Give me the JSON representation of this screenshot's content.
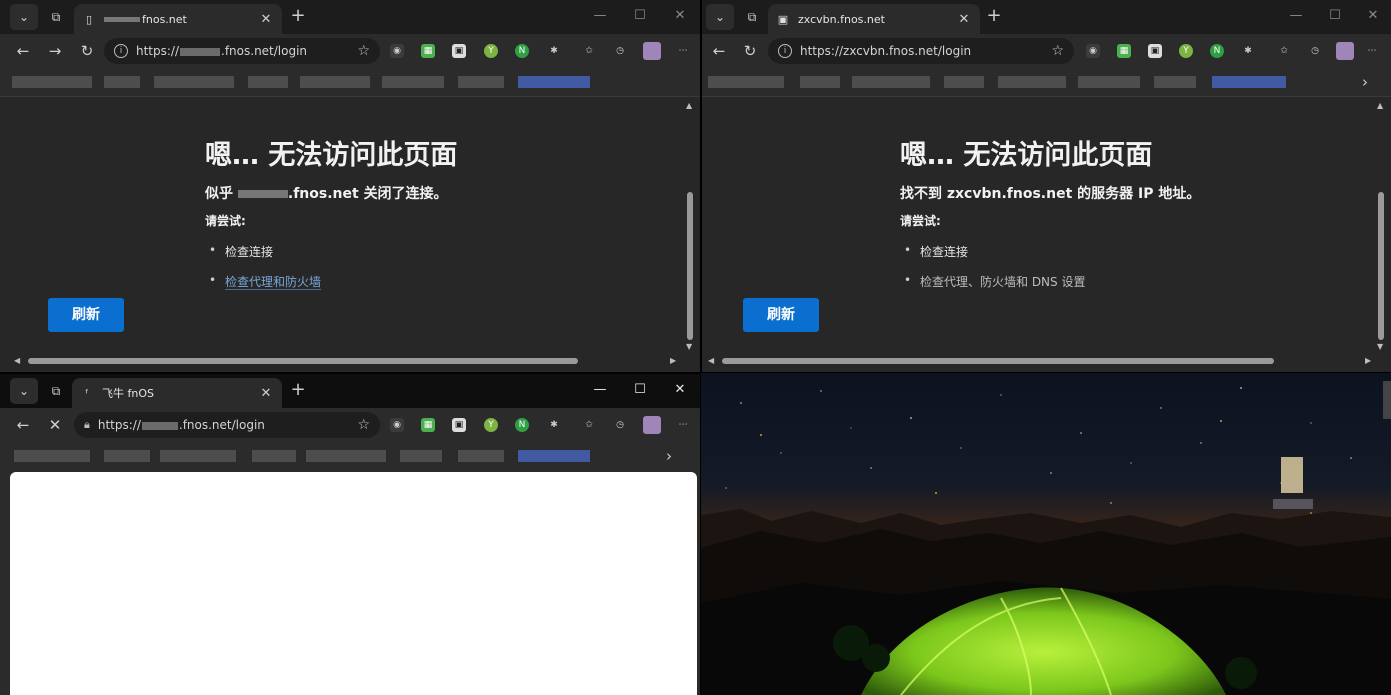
{
  "windows": {
    "top_left": {
      "tab_title": "fnos.net",
      "url": "https://",
      "url_suffix": ".fnos.net/login",
      "error_title": "嗯… 无法访问此页面",
      "error_subtitle_prefix": "似乎",
      "error_subtitle_host": ".fnos.net",
      "error_subtitle_suffix": "关闭了连接。",
      "try_label": "请尝试:",
      "suggestions": [
        "检查连接",
        "检查代理和防火墙"
      ],
      "refresh_label": "刷新"
    },
    "top_right": {
      "tab_title": "zxcvbn.fnos.net",
      "url": "https://zxcvbn.fnos.net/login",
      "error_title": "嗯… 无法访问此页面",
      "error_subtitle_prefix": "找不到",
      "error_subtitle_host": "zxcvbn.fnos.net",
      "error_subtitle_suffix": "的服务器 IP 地址。",
      "try_label": "请尝试:",
      "suggestions": [
        "检查连接",
        "检查代理、防火墙和 DNS 设置"
      ],
      "refresh_label": "刷新"
    },
    "bottom_left": {
      "tab_title": "飞牛 fnOS",
      "url": "https://",
      "url_suffix": ".fnos.net/login"
    }
  },
  "icons": {
    "tab_actions": "chevron-down-icon",
    "workspaces": "workspaces-icon",
    "new_tab": "plus-icon",
    "minimize": "minimize-icon",
    "maximize": "maximize-icon",
    "close": "close-icon",
    "back": "arrow-left-icon",
    "forward": "arrow-right-icon",
    "refresh": "refresh-icon",
    "stop": "stop-icon",
    "favorite": "star-icon",
    "extensions": "puzzle-icon",
    "collections": "favorites-icon",
    "history": "history-icon",
    "more": "more-icon"
  },
  "colors": {
    "refresh_button": "#0b6fd0",
    "link": "#7aa7d9",
    "tent": "#8ee02a"
  }
}
